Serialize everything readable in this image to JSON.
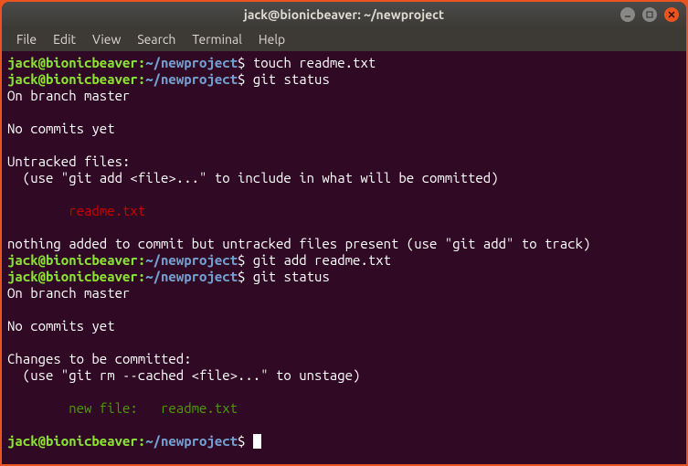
{
  "title": "jack@bionicbeaver: ~/newproject",
  "menu": {
    "file": "File",
    "edit": "Edit",
    "view": "View",
    "search": "Search",
    "terminal": "Terminal",
    "help": "Help"
  },
  "prompt": {
    "userhost": "jack@bionicbeaver",
    "colon": ":",
    "path": "~/newproject",
    "dollar": "$"
  },
  "cmds": {
    "touch": " touch readme.txt",
    "status1": " git status",
    "add": " git add readme.txt",
    "status2": " git status",
    "empty": " "
  },
  "out": {
    "on_branch": "On branch master",
    "no_commits": "No commits yet",
    "untracked_header": "Untracked files:",
    "untracked_hint": "  (use \"git add <file>...\" to include in what will be committed)",
    "untracked_file": "        readme.txt",
    "nothing_added": "nothing added to commit but untracked files present (use \"git add\" to track)",
    "changes_header": "Changes to be committed:",
    "changes_hint": "  (use \"git rm --cached <file>...\" to unstage)",
    "new_file": "        new file:   readme.txt"
  }
}
